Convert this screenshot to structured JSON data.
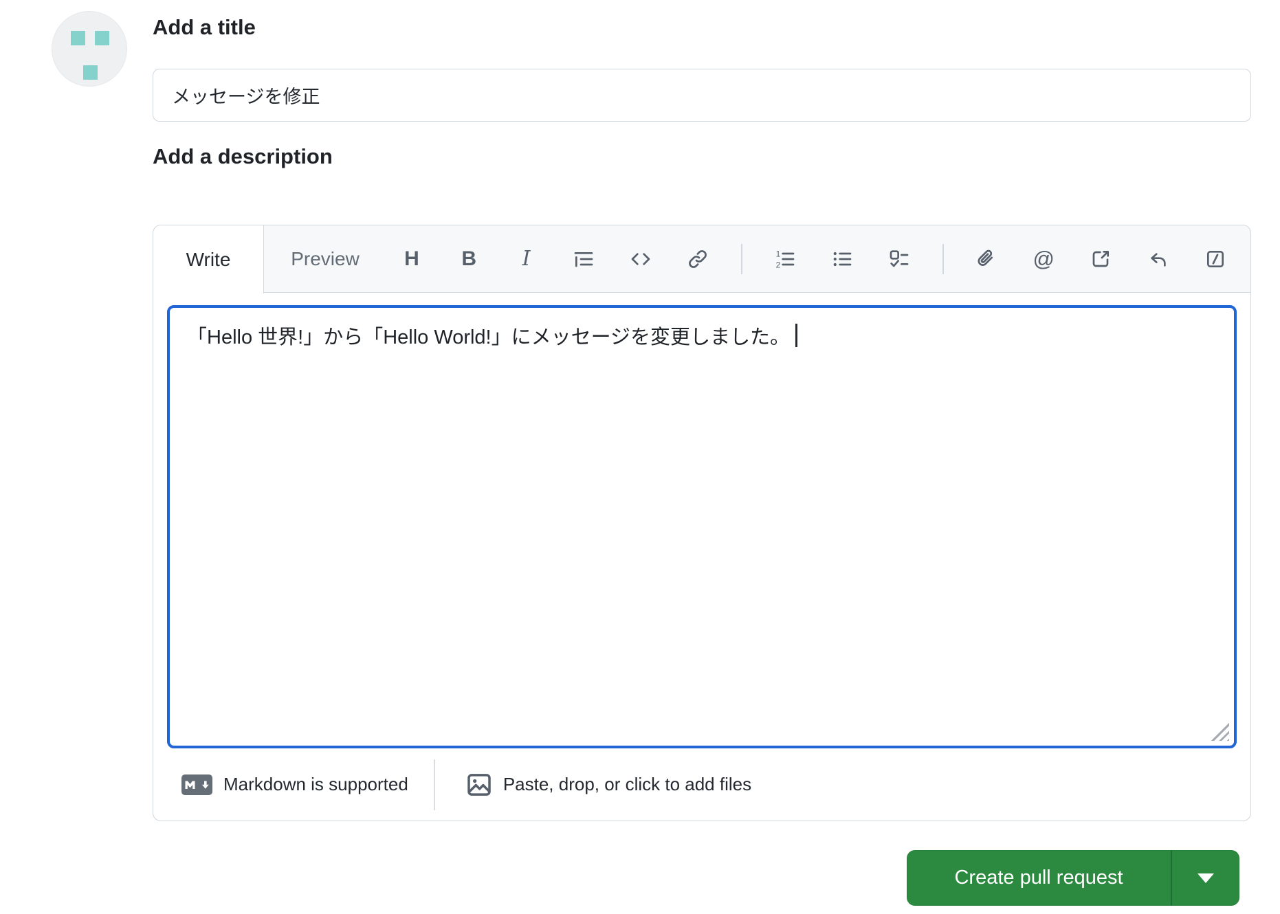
{
  "title_section": {
    "heading": "Add a title",
    "value": "メッセージを修正"
  },
  "description_section": {
    "heading": "Add a description",
    "tabs": [
      {
        "label": "Write",
        "active": true
      },
      {
        "label": "Preview",
        "active": false
      }
    ],
    "toolbar_glyphs": {
      "heading": "H",
      "bold": "B",
      "italic": "I",
      "mention": "@"
    },
    "toolbar_icons": [
      "heading",
      "bold",
      "italic",
      "quote",
      "code",
      "link",
      "numbered-list",
      "bulleted-list",
      "task-list",
      "attach-file",
      "mention",
      "cross-reference",
      "saved-replies",
      "slash-commands"
    ],
    "text": "「Hello 世界!」から「Hello World!」にメッセージを変更しました。",
    "footer": {
      "markdown_hint": "Markdown is supported",
      "paste_hint": "Paste, drop, or click to add files"
    }
  },
  "actions": {
    "create_label": "Create pull request"
  },
  "colors": {
    "focus_blue": "#2265d4",
    "button_green": "#2c8a40",
    "border_gray": "#d0d7de",
    "header_bg": "#f6f8fa",
    "muted_text": "#636c76",
    "identicon_teal": "#84d2cb"
  }
}
